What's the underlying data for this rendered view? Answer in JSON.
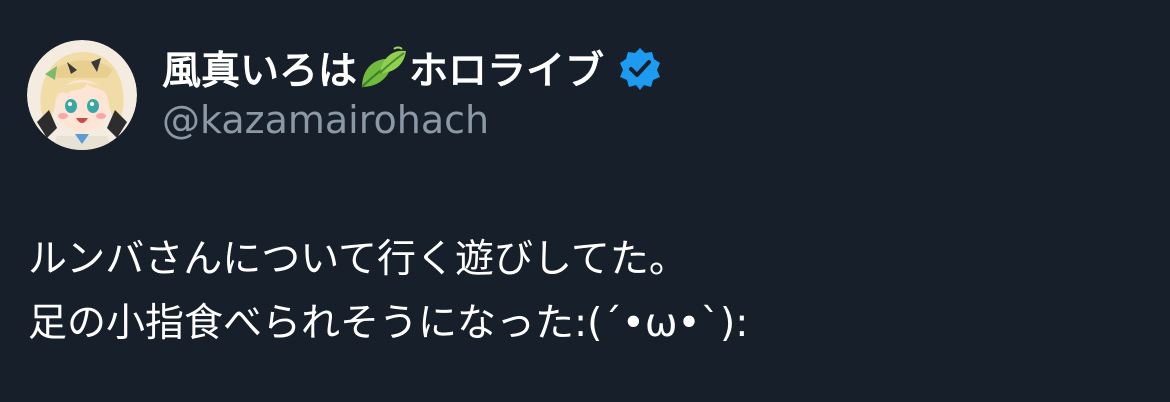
{
  "author": {
    "name_prefix": "風真いろは",
    "name_emoji": "leaf-emoji",
    "name_suffix": "ホロライブ",
    "verified": true,
    "verified_color": "#1d9bf0",
    "handle": "@kazamairohach",
    "avatar_icon": "anime-avatar-icon"
  },
  "tweet": {
    "lines": [
      "ルンバさんについて行く遊びしてた。",
      "足の小指食べられそうになった:(´•ω•`):"
    ]
  },
  "colors": {
    "background": "#17202a",
    "text_primary": "#ffffff",
    "text_secondary": "#8b98a5"
  }
}
